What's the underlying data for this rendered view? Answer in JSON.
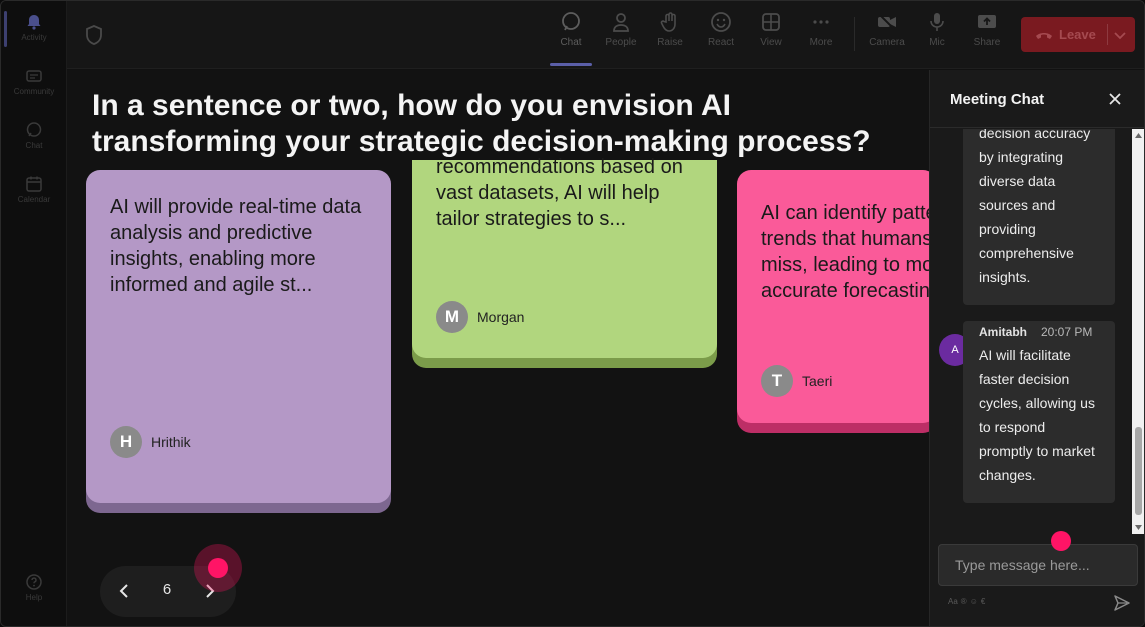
{
  "rail": {
    "items": [
      {
        "label": "Activity",
        "icon": "bell-icon",
        "active": true
      },
      {
        "label": "Community",
        "icon": "community-icon"
      },
      {
        "label": "Chat",
        "icon": "chat-icon"
      },
      {
        "label": "Calendar",
        "icon": "calendar-icon"
      },
      {
        "label": "Help",
        "icon": "help-icon"
      }
    ]
  },
  "toolbar": {
    "items": [
      {
        "label": "Chat",
        "icon": "chat-icon"
      },
      {
        "label": "People",
        "icon": "people-icon"
      },
      {
        "label": "Raise",
        "icon": "hand-icon"
      },
      {
        "label": "React",
        "icon": "smile-icon"
      },
      {
        "label": "View",
        "icon": "grid-icon"
      },
      {
        "label": "More",
        "icon": "more-icon"
      },
      {
        "label": "Camera",
        "icon": "camera-off-icon"
      },
      {
        "label": "Mic",
        "icon": "mic-icon"
      },
      {
        "label": "Share",
        "icon": "share-icon"
      }
    ],
    "leave_label": "Leave"
  },
  "question": "In a sentence or two, how do you envision AI transforming your strategic decision-making process?",
  "cards": [
    {
      "text": "AI will provide real-time data analysis and predictive insights, enabling more informed and agile st...",
      "author": "Hrithik",
      "initial": "H",
      "color": "#b498c6"
    },
    {
      "text": "recommendations based on vast datasets, AI will help tailor strategies to s...",
      "author": "Morgan",
      "initial": "M",
      "color": "#b1d67e"
    },
    {
      "text": "AI can identify patterns and trends that humans might miss, leading to more accurate forecasting",
      "author": "Taeri",
      "initial": "T",
      "color": "#fa5a99"
    }
  ],
  "pager": {
    "page": "6"
  },
  "chat": {
    "title": "Meeting Chat",
    "messages": [
      {
        "text": "decision accuracy by integrating diverse data sources and providing comprehensive insights."
      },
      {
        "author": "Amitabh",
        "time": "20:07 PM",
        "initial": "A",
        "text": "AI will facilitate faster decision cycles, allowing us to respond promptly to market changes."
      }
    ],
    "input_placeholder": "Type message here...",
    "formatting": [
      "Aa",
      "®",
      "☺",
      "€"
    ]
  },
  "colors": {
    "accent": "#5b5fa8",
    "leave": "#c4262e",
    "pointer": "#ff1466"
  }
}
